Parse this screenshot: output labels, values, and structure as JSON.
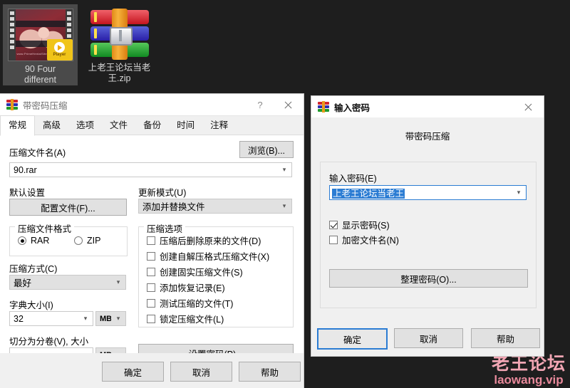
{
  "desktop": {
    "icons": [
      {
        "name": "video-file",
        "label_line1": "90 Four",
        "label_line2": "different",
        "thumb_url_text": "www.PrimeHentaiSites.com",
        "badge": "Player",
        "selected": true
      },
      {
        "name": "rar-archive",
        "label_line1": "上老王论坛当老",
        "label_line2": "王.zip",
        "selected": false
      }
    ]
  },
  "watermark": {
    "cn": "老王论坛",
    "en": "laowang.vip",
    "color": "#f2a6b4"
  },
  "archive_dialog": {
    "title": "带密码压缩",
    "help_glyph": "?",
    "tabs": [
      {
        "label": "常规",
        "active": true
      },
      {
        "label": "高级",
        "active": false
      },
      {
        "label": "选项",
        "active": false
      },
      {
        "label": "文件",
        "active": false
      },
      {
        "label": "备份",
        "active": false
      },
      {
        "label": "时间",
        "active": false
      },
      {
        "label": "注释",
        "active": false
      }
    ],
    "archive_name_label": "压缩文件名(A)",
    "browse_button": "浏览(B)...",
    "archive_name_value": "90.rar",
    "default_settings_label": "默认设置",
    "profile_button": "配置文件(F)...",
    "update_mode_label": "更新模式(U)",
    "update_mode_value": "添加并替换文件",
    "format_group_title": "压缩文件格式",
    "format_options": [
      {
        "label": "RAR",
        "checked": true
      },
      {
        "label": "ZIP",
        "checked": false
      }
    ],
    "method_label": "压缩方式(C)",
    "method_value": "最好",
    "dict_label": "字典大小(I)",
    "dict_value": "32",
    "dict_unit": "MB",
    "volume_label": "切分为分卷(V), 大小",
    "volume_value": "",
    "volume_unit": "MB",
    "options_group_title": "压缩选项",
    "options": [
      {
        "label": "压缩后删除原来的文件(D)",
        "checked": false
      },
      {
        "label": "创建自解压格式压缩文件(X)",
        "checked": false
      },
      {
        "label": "创建固实压缩文件(S)",
        "checked": false
      },
      {
        "label": "添加恢复记录(E)",
        "checked": false
      },
      {
        "label": "测试压缩的文件(T)",
        "checked": false
      },
      {
        "label": "锁定压缩文件(L)",
        "checked": false
      }
    ],
    "set_password_button": "设置密码(P)...",
    "ok_button": "确定",
    "cancel_button": "取消",
    "help_button": "帮助"
  },
  "password_dialog": {
    "title": "输入密码",
    "heading": "带密码压缩",
    "password_label": "输入密码(E)",
    "password_value": "上老王论坛当老王",
    "password_selected": true,
    "show_password": {
      "label": "显示密码(S)",
      "checked": true
    },
    "encrypt_filenames": {
      "label": "加密文件名(N)",
      "checked": false
    },
    "organize_button": "整理密码(O)...",
    "ok_button": "确定",
    "cancel_button": "取消",
    "help_button": "帮助",
    "accent_color": "#2b7cd3"
  }
}
